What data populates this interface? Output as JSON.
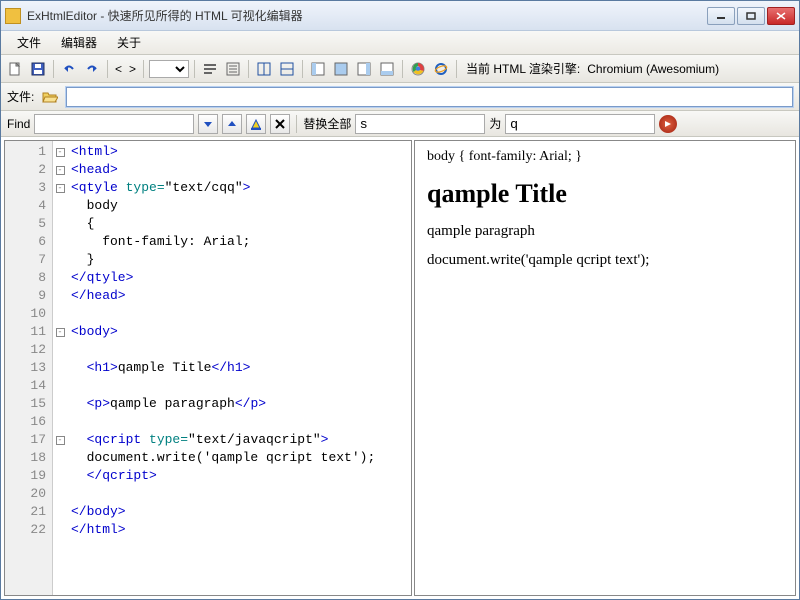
{
  "title": "ExHtmlEditor - 快速所见所得的 HTML 可视化编辑器",
  "menu": {
    "file": "文件",
    "editor": "编辑器",
    "about": "关于"
  },
  "toolbar": {
    "render_label": "当前 HTML 渲染引擎:",
    "render_value": "Chromium (Awesomium)",
    "lt": "<",
    "gt": ">"
  },
  "filebar": {
    "label": "文件:",
    "value": ""
  },
  "find": {
    "label": "Find",
    "value": "",
    "replace_all_label": "替换全部",
    "replace_from": "s",
    "to_label": "为",
    "replace_to": "q"
  },
  "code": {
    "lines": [
      {
        "n": 1,
        "fold": "-",
        "seg": [
          {
            "c": "t-tag",
            "t": "<html>"
          }
        ]
      },
      {
        "n": 2,
        "fold": "-",
        "seg": [
          {
            "c": "t-tag",
            "t": "<head>"
          }
        ]
      },
      {
        "n": 3,
        "fold": "-",
        "seg": [
          {
            "c": "t-tag",
            "t": "<qtyle "
          },
          {
            "c": "t-attr",
            "t": "type="
          },
          {
            "c": "t-text",
            "t": "\"text/cqq\""
          },
          {
            "c": "t-tag",
            "t": ">"
          }
        ]
      },
      {
        "n": 4,
        "fold": "",
        "seg": [
          {
            "c": "t-text",
            "t": "  body"
          }
        ]
      },
      {
        "n": 5,
        "fold": "",
        "seg": [
          {
            "c": "t-text",
            "t": "  {"
          }
        ]
      },
      {
        "n": 6,
        "fold": "",
        "seg": [
          {
            "c": "t-text",
            "t": "    font-family: Arial;"
          }
        ]
      },
      {
        "n": 7,
        "fold": "",
        "seg": [
          {
            "c": "t-text",
            "t": "  }"
          }
        ]
      },
      {
        "n": 8,
        "fold": "",
        "seg": [
          {
            "c": "t-tag",
            "t": "</qtyle>"
          }
        ]
      },
      {
        "n": 9,
        "fold": "",
        "seg": [
          {
            "c": "t-tag",
            "t": "</head>"
          }
        ]
      },
      {
        "n": 10,
        "fold": "",
        "seg": [
          {
            "c": "t-text",
            "t": ""
          }
        ]
      },
      {
        "n": 11,
        "fold": "-",
        "seg": [
          {
            "c": "t-tag",
            "t": "<body>"
          }
        ]
      },
      {
        "n": 12,
        "fold": "",
        "seg": [
          {
            "c": "t-text",
            "t": ""
          }
        ]
      },
      {
        "n": 13,
        "fold": "",
        "seg": [
          {
            "c": "t-text",
            "t": "  "
          },
          {
            "c": "t-tag",
            "t": "<h1>"
          },
          {
            "c": "t-text",
            "t": "qample Title"
          },
          {
            "c": "t-tag",
            "t": "</h1>"
          }
        ]
      },
      {
        "n": 14,
        "fold": "",
        "seg": [
          {
            "c": "t-text",
            "t": ""
          }
        ]
      },
      {
        "n": 15,
        "fold": "",
        "seg": [
          {
            "c": "t-text",
            "t": "  "
          },
          {
            "c": "t-tag",
            "t": "<p>"
          },
          {
            "c": "t-text",
            "t": "qample paragraph"
          },
          {
            "c": "t-tag",
            "t": "</p>"
          }
        ]
      },
      {
        "n": 16,
        "fold": "",
        "seg": [
          {
            "c": "t-text",
            "t": ""
          }
        ]
      },
      {
        "n": 17,
        "fold": "-",
        "seg": [
          {
            "c": "t-text",
            "t": "  "
          },
          {
            "c": "t-tag",
            "t": "<qcript "
          },
          {
            "c": "t-attr",
            "t": "type="
          },
          {
            "c": "t-text",
            "t": "\"text/javaqcript\""
          },
          {
            "c": "t-tag",
            "t": ">"
          }
        ]
      },
      {
        "n": 18,
        "fold": "",
        "seg": [
          {
            "c": "t-text",
            "t": "  document.write('qample qcript text');"
          }
        ]
      },
      {
        "n": 19,
        "fold": "",
        "seg": [
          {
            "c": "t-text",
            "t": "  "
          },
          {
            "c": "t-tag",
            "t": "</qcript>"
          }
        ]
      },
      {
        "n": 20,
        "fold": "",
        "seg": [
          {
            "c": "t-text",
            "t": ""
          }
        ]
      },
      {
        "n": 21,
        "fold": "",
        "seg": [
          {
            "c": "t-tag",
            "t": "</body>"
          }
        ]
      },
      {
        "n": 22,
        "fold": "",
        "seg": [
          {
            "c": "t-tag",
            "t": "</html>"
          }
        ]
      }
    ]
  },
  "preview": {
    "body_rule": "body { font-family: Arial; }",
    "h1": "qample Title",
    "p": "qample paragraph",
    "script_text": "document.write('qample qcript text');"
  }
}
